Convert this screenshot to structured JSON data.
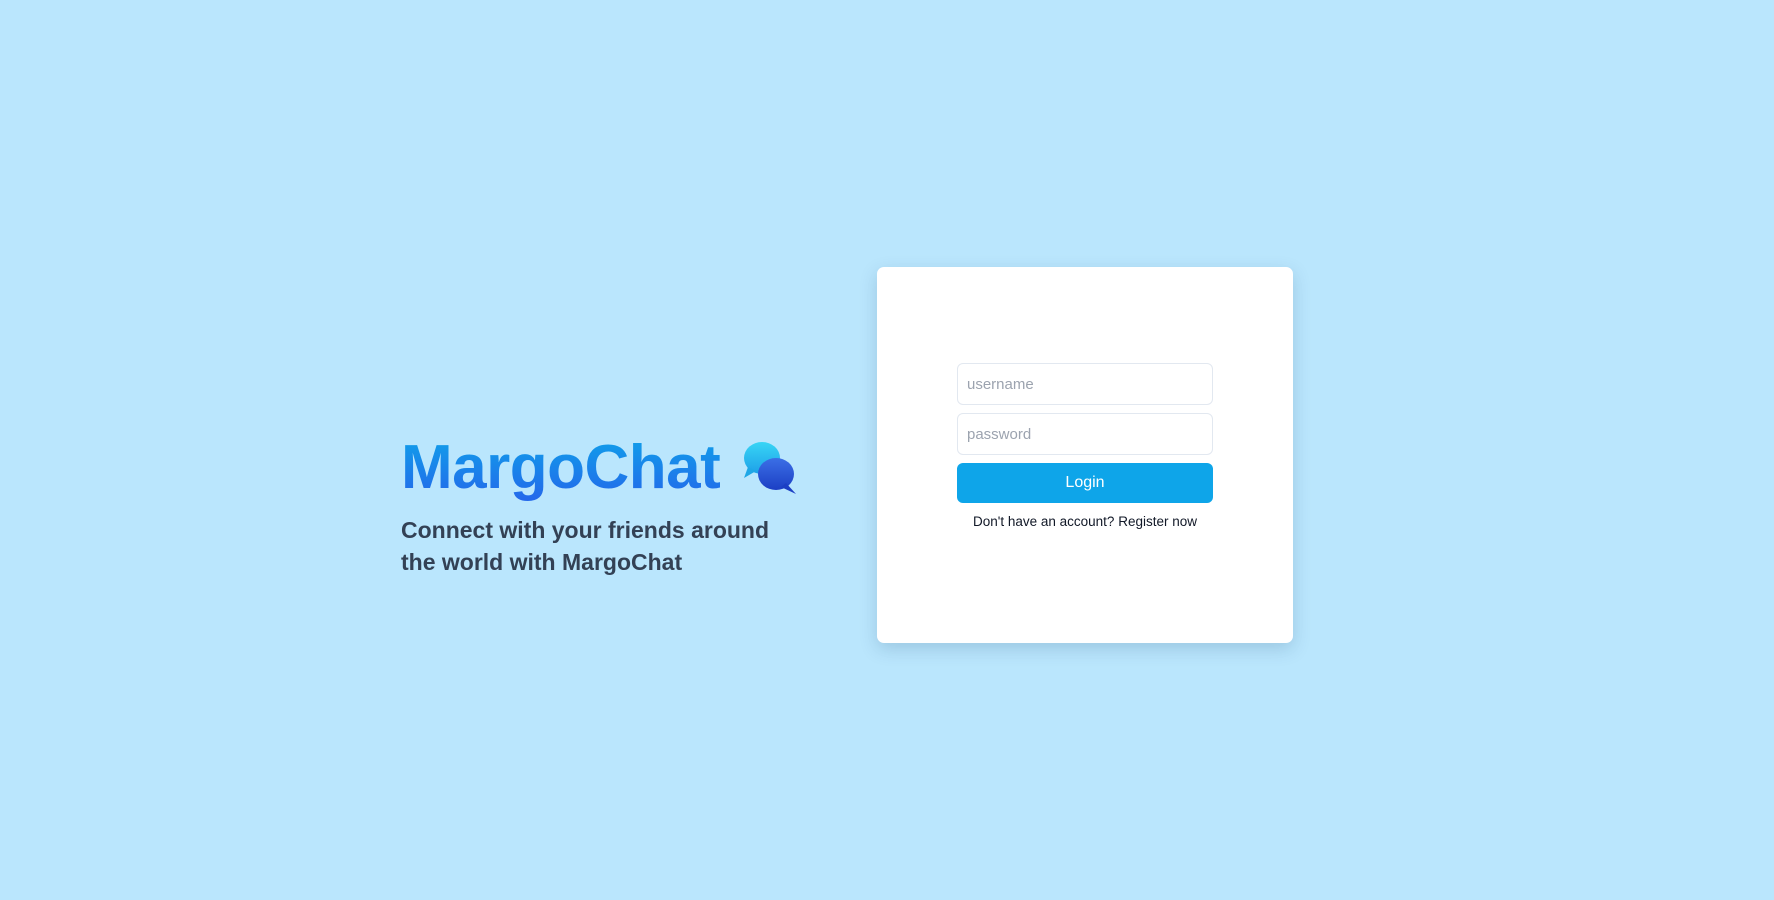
{
  "branding": {
    "title": "MargoChat",
    "icon": "chat-bubbles-icon",
    "tagline": "Connect with your friends around the world with MargoChat"
  },
  "login_form": {
    "username_placeholder": "username",
    "username_value": "",
    "password_placeholder": "password",
    "password_value": "",
    "login_label": "Login",
    "register_prompt": "Don't have an account?",
    "register_link": "Register now"
  },
  "colors": {
    "background": "#bae6fd",
    "card": "#ffffff",
    "accent": "#0ea5e9",
    "title_gradient_start": "#0ea5e9",
    "title_gradient_end": "#2563eb",
    "tagline": "#334155"
  }
}
